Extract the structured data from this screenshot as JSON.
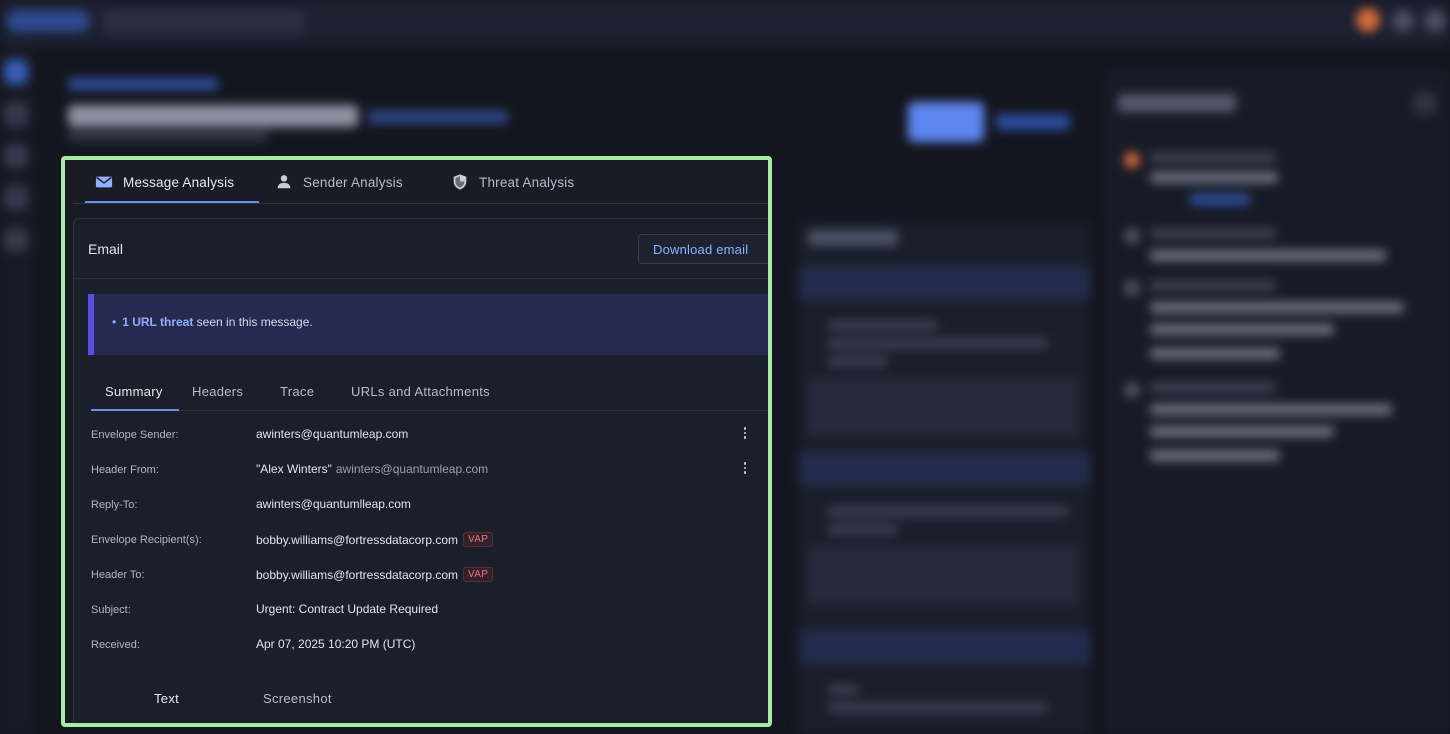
{
  "tabs": [
    {
      "label": "Message Analysis",
      "icon": "envelope-icon",
      "active": true
    },
    {
      "label": "Sender Analysis",
      "icon": "person-icon",
      "active": false
    },
    {
      "label": "Threat Analysis",
      "icon": "shield-icon",
      "active": false
    }
  ],
  "email_card": {
    "title": "Email",
    "download_label": "Download email"
  },
  "alert": {
    "link_text": "1 URL threat",
    "rest_text": " seen in this message."
  },
  "subtabs": [
    "Summary",
    "Headers",
    "Trace",
    "URLs and Attachments"
  ],
  "summary": {
    "envelope_sender": {
      "label": "Envelope Sender:",
      "value": "awinters@quantumleap.com"
    },
    "header_from": {
      "label": "Header From:",
      "name": "\"Alex Winters\"",
      "email": "awinters@quantumleap.com"
    },
    "reply_to": {
      "label": "Reply-To:",
      "value": "awinters@quantumlleap.com"
    },
    "envelope_recipients": {
      "label": "Envelope Recipient(s):",
      "value": "bobby.williams@fortressdatacorp.com",
      "badge": "VAP"
    },
    "header_to": {
      "label": "Header To:",
      "value": "bobby.williams@fortressdatacorp.com",
      "badge": "VAP"
    },
    "subject": {
      "label": "Subject:",
      "value": "Urgent: Contract Update Required"
    },
    "received": {
      "label": "Received:",
      "value": "Apr 07, 2025 10:20 PM (UTC)"
    }
  },
  "view_tabs": [
    "Text",
    "Screenshot"
  ],
  "colors": {
    "highlight_border": "#a8eaa6",
    "accent": "#6d8fe6",
    "link": "#8fb0ff",
    "alert_bar": "#5a4fe0",
    "vap_badge": "#e27a8a"
  }
}
